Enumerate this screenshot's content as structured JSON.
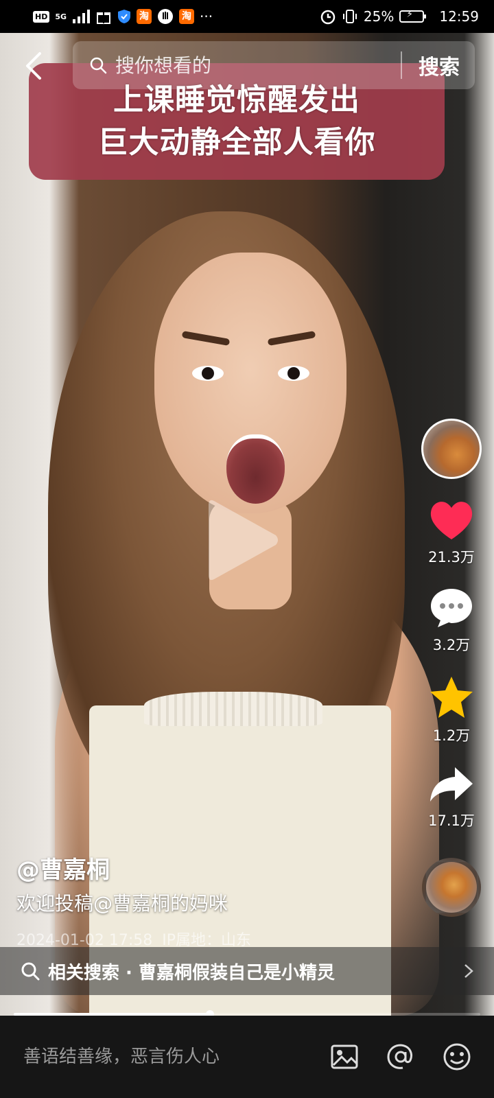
{
  "status_bar": {
    "hd_label": "HD",
    "network_label": "5G",
    "battery_percent": "25%",
    "time": "12:59",
    "more_label": "···",
    "taobao_label": "淘"
  },
  "search": {
    "placeholder": "搜你想看的",
    "button_label": "搜索"
  },
  "video": {
    "caption_line1": "上课睡觉惊醒发出",
    "caption_line2": "巨大动静全部人看你",
    "progress": 0.42
  },
  "actions": {
    "likes": "21.3万",
    "comments": "3.2万",
    "favorites": "1.2万",
    "shares": "17.1万"
  },
  "post": {
    "author": "@曹嘉桐",
    "description": "欢迎投稿@曹嘉桐的妈咪",
    "datetime": "2024-01-02 17:58",
    "ip_location": "IP属地：山东"
  },
  "related": {
    "text": "相关搜索 · 曹嘉桐假装自己是小精灵"
  },
  "comment_bar": {
    "placeholder": "善语结善缘，恶言伤人心"
  },
  "colors": {
    "like": "#fe2c55",
    "favorite": "#ffc300",
    "caption_bg": "#a13d4c"
  }
}
